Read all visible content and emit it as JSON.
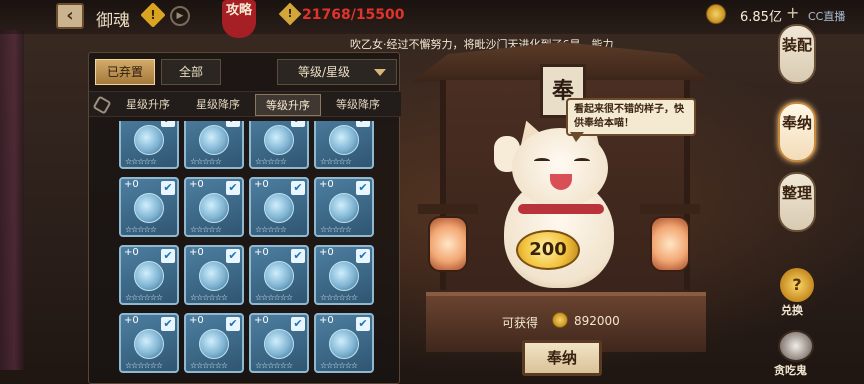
{
  "header": {
    "title": "御魂",
    "guide_label": "攻略",
    "capacity": "21768/15500",
    "currency": "6.85亿",
    "plus": "+",
    "cc": "CC直播"
  },
  "marquee": "吹乙女·经过不懈努力，将毗沙门天进化到了6星，能力",
  "panel": {
    "filter_abandoned": "已弃置",
    "filter_all": "全部",
    "sort_select": "等级/星级",
    "sort_tabs": [
      "星级升序",
      "星级降序",
      "等级升序",
      "等级降序"
    ],
    "active_sort_index": 2
  },
  "cards": [
    {
      "plus": "",
      "checked": true,
      "stars": "☆☆☆☆☆"
    },
    {
      "plus": "",
      "checked": true,
      "stars": "☆☆☆☆☆"
    },
    {
      "plus": "",
      "checked": true,
      "stars": "☆☆☆☆☆"
    },
    {
      "plus": "",
      "checked": true,
      "stars": "☆☆☆☆☆"
    },
    {
      "plus": "+0",
      "checked": true,
      "stars": "☆☆☆☆☆"
    },
    {
      "plus": "+0",
      "checked": true,
      "stars": "☆☆☆☆☆"
    },
    {
      "plus": "+0",
      "checked": true,
      "stars": "☆☆☆☆☆"
    },
    {
      "plus": "+0",
      "checked": true,
      "stars": "☆☆☆☆☆"
    },
    {
      "plus": "+0",
      "checked": true,
      "stars": "☆☆☆☆☆☆"
    },
    {
      "plus": "+0",
      "checked": true,
      "stars": "☆☆☆☆☆☆"
    },
    {
      "plus": "+0",
      "checked": true,
      "stars": "☆☆☆☆☆☆"
    },
    {
      "plus": "+0",
      "checked": true,
      "stars": "☆☆☆☆☆☆"
    },
    {
      "plus": "+0",
      "checked": true,
      "stars": "☆☆☆☆☆☆"
    },
    {
      "plus": "+0",
      "checked": true,
      "stars": "☆☆☆☆☆☆"
    },
    {
      "plus": "+0",
      "checked": true,
      "stars": "☆☆☆☆☆☆"
    },
    {
      "plus": "+0",
      "checked": true,
      "stars": "☆☆☆☆☆☆"
    }
  ],
  "shrine": {
    "sign": "奉",
    "speech": "看起来很不错的样子，快供奉给本喵！",
    "koban": "200",
    "obtain_label": "可获得",
    "obtain_amount": "892000",
    "offer_button": "奉纳"
  },
  "side_tabs": {
    "equip": "装配",
    "offer": "奉纳",
    "sort": "整理",
    "exchange_icon": "?",
    "exchange": "兑换",
    "glutton": "贪吃鬼"
  },
  "icons": {
    "back": "chevron-left-icon",
    "warn": "warning-icon",
    "play": "play-icon",
    "coin": "coin-icon",
    "hex": "hexagon-icon",
    "caret": "caret-down-icon"
  }
}
